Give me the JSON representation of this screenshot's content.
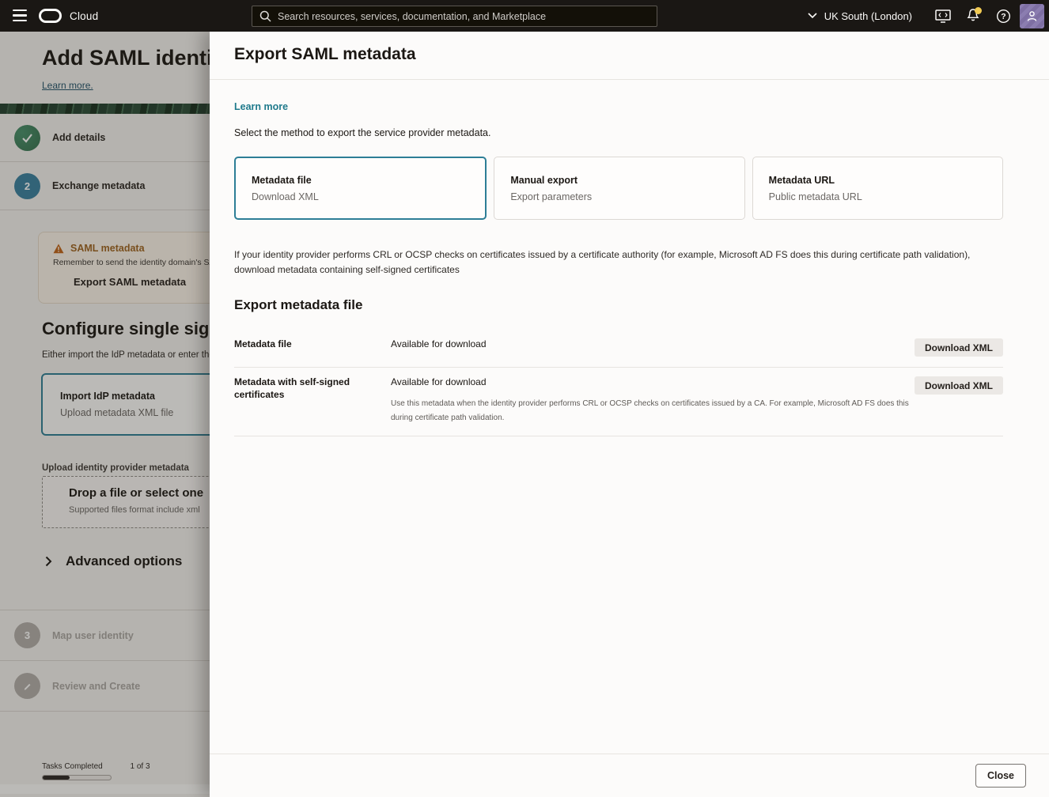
{
  "topbar": {
    "brand": "Cloud",
    "search_placeholder": "Search resources, services, documentation, and Marketplace",
    "region": "UK South (London)"
  },
  "left_page": {
    "title": "Add SAML identity pro",
    "learn_more": "Learn more.",
    "steps": [
      {
        "icon": "check-icon",
        "label": "Add details",
        "state": "done"
      },
      {
        "number": "2",
        "label": "Exchange metadata",
        "state": "active"
      },
      {
        "number": "3",
        "label": "Map user identity",
        "state": "disabled"
      },
      {
        "icon": "pencil-icon",
        "label": "Review and Create",
        "state": "disabled"
      }
    ],
    "warning": {
      "title": "SAML metadata",
      "body": "Remember to send the identity domain's SA",
      "action": "Export SAML metadata"
    },
    "sso": {
      "title": "Configure single sign-o",
      "subtitle": "Either import the IdP metadata or enter the",
      "card_title": "Import IdP metadata",
      "card_subtitle": "Upload metadata XML file",
      "upload_label": "Upload identity provider metadata",
      "drop_title": "Drop a file or select one",
      "drop_subtitle": "Supported files format include xml",
      "advanced_label": "Advanced options"
    },
    "footer": {
      "tasks_label": "Tasks Completed",
      "tasks_value": "1 of 3"
    }
  },
  "panel": {
    "title": "Export SAML metadata",
    "learn_more": "Learn more",
    "intro": "Select the method to export the service provider metadata.",
    "methods": [
      {
        "title": "Metadata file",
        "subtitle": "Download XML",
        "selected": true
      },
      {
        "title": "Manual export",
        "subtitle": "Export parameters",
        "selected": false
      },
      {
        "title": "Metadata URL",
        "subtitle": "Public metadata URL",
        "selected": false
      }
    ],
    "note": "If your identity provider performs CRL or OCSP checks on certificates issued by a certificate authority (for example, Microsoft AD FS does this during certificate path validation), download metadata containing self-signed certificates",
    "section_title": "Export metadata file",
    "rows": [
      {
        "label": "Metadata file",
        "status": "Available for download",
        "button": "Download XML"
      },
      {
        "label": "Metadata with self-signed certificates",
        "status": "Available for download",
        "description": "Use this metadata when the identity provider performs CRL or OCSP checks on certificates issued by a CA. For example, Microsoft AD FS does this during certificate path validation.",
        "button": "Download XML"
      }
    ],
    "close_label": "Close"
  },
  "colors": {
    "topbar_bg": "#1a1714",
    "accent_teal": "#2d7e96",
    "link_teal": "#1f7a8c",
    "warning_orange": "#9e6420",
    "success_green": "#35714f",
    "active_step_blue": "#38809f",
    "avatar_purple": "#8b7db0",
    "badge_yellow": "#f2cb52"
  }
}
